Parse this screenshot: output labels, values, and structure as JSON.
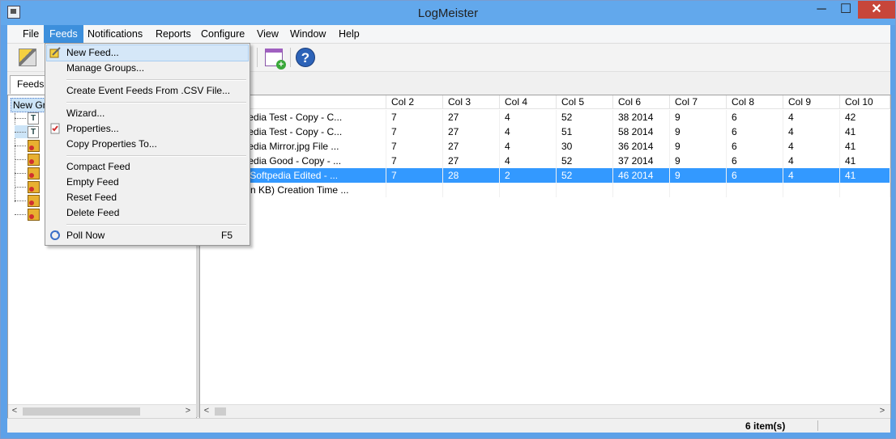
{
  "window": {
    "title": "LogMeister",
    "minimize": "─",
    "maximize": "☐",
    "close": "✕"
  },
  "menubar": {
    "items": [
      "File",
      "Feeds",
      "Notifications",
      "Reports",
      "Configure",
      "View",
      "Window",
      "Help"
    ],
    "active": "Feeds"
  },
  "toolbar": {
    "buttons": [
      "wand-icon",
      "calendar-add-icon",
      "help-icon"
    ],
    "help_glyph": "?",
    "plus_glyph": "+"
  },
  "tabs": {
    "feeds": "Feeds"
  },
  "tree": {
    "root_label": "New Gro",
    "nodes": [
      {
        "icon": "text-feed-icon",
        "glyph": "T"
      },
      {
        "icon": "text-feed-icon",
        "glyph": "T"
      },
      {
        "icon": "event-feed-icon"
      },
      {
        "icon": "event-feed-icon"
      },
      {
        "icon": "event-feed-icon"
      },
      {
        "icon": "event-feed-icon"
      },
      {
        "icon": "event-feed-icon"
      },
      {
        "icon": "event-feed-icon"
      }
    ]
  },
  "table": {
    "columns": [
      "",
      "Col 2",
      "Col 3",
      "Col 4",
      "Col 5",
      "Col 6",
      "Col 7",
      "Col 8",
      "Col 9",
      "Col 10"
    ],
    "rows": [
      [
        "Test\\Softpedia Test - Copy - C...",
        "7",
        "27",
        "4",
        "52",
        "38 2014",
        "9",
        "6",
        "4",
        "42"
      ],
      [
        "Test\\Softpedia Test - Copy - C...",
        "7",
        "27",
        "4",
        "51",
        "58 2014",
        "9",
        "6",
        "4",
        "41"
      ],
      [
        "Test\\Softpedia Mirror.jpg File ...",
        "7",
        "27",
        "4",
        "30",
        "36 2014",
        "9",
        "6",
        "4",
        "41"
      ],
      [
        "Test\\Softpedia Good - Copy - ...",
        "7",
        "27",
        "4",
        "52",
        "37 2014",
        "9",
        "6",
        "4",
        "41"
      ],
      [
        "Test\\proc_Softpedia Edited - ...",
        "7",
        "28",
        "2",
        "52",
        "46 2014",
        "9",
        "6",
        "4",
        "41"
      ],
      [
        "ype Size (in KB) Creation Time ...",
        "",
        "",
        "",
        "",
        "",
        "",
        "",
        "",
        ""
      ]
    ],
    "selected_row": 4
  },
  "scroll": {
    "left_arrow": "<",
    "right_arrow": ">"
  },
  "feeds_menu": {
    "items": [
      {
        "label": "New Feed...",
        "icon": "new-feed-icon"
      },
      {
        "label": "Manage Groups..."
      },
      {
        "sep": true
      },
      {
        "label": "Create Event Feeds From .CSV File..."
      },
      {
        "sep": true
      },
      {
        "label": "Wizard..."
      },
      {
        "label": "Properties...",
        "icon": "properties-icon"
      },
      {
        "label": "Copy Properties To..."
      },
      {
        "sep": true
      },
      {
        "label": "Compact Feed"
      },
      {
        "label": "Empty Feed"
      },
      {
        "label": "Reset Feed"
      },
      {
        "label": "Delete Feed"
      },
      {
        "sep": true
      },
      {
        "label": "Poll Now",
        "icon": "poll-now-icon",
        "shortcut": "F5"
      }
    ]
  },
  "status": {
    "items_count": "6 item(s)"
  }
}
